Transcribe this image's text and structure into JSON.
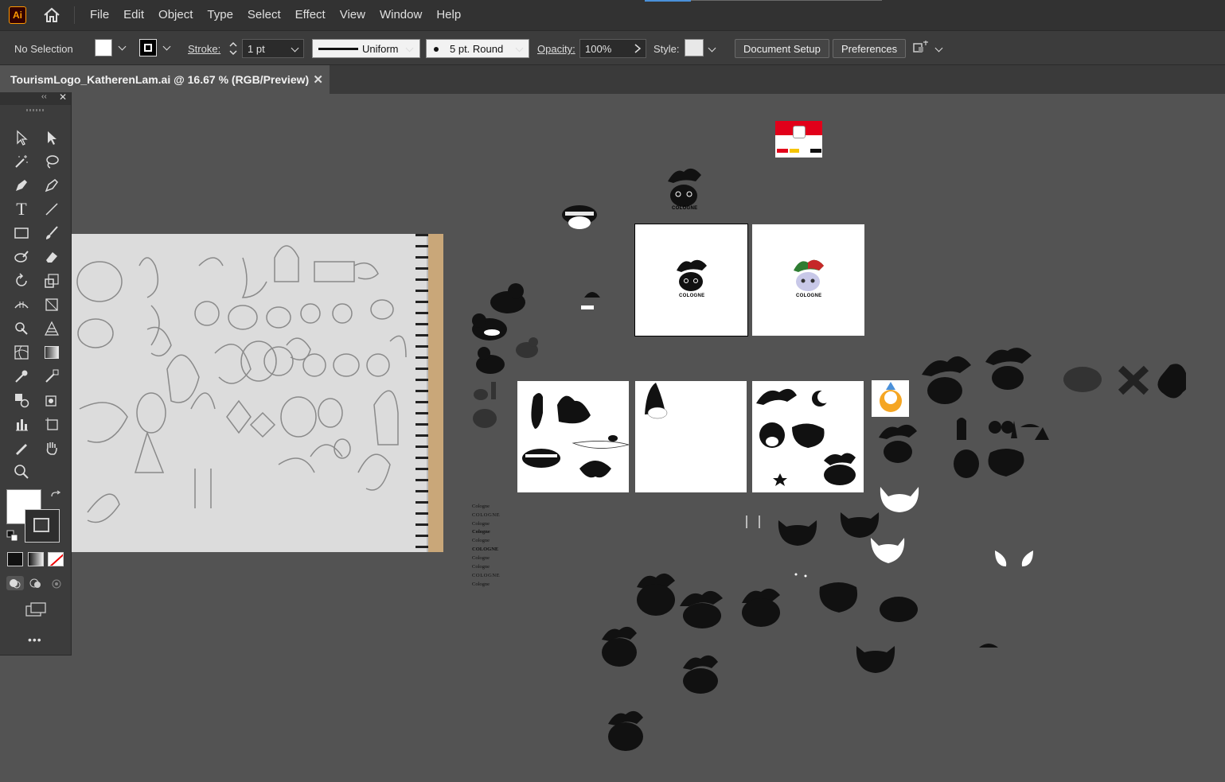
{
  "app": {
    "logo_text": "Ai"
  },
  "menu": [
    "File",
    "Edit",
    "Object",
    "Type",
    "Select",
    "Effect",
    "View",
    "Window",
    "Help"
  ],
  "control_bar": {
    "selection": "No Selection",
    "stroke_label": "Stroke:",
    "stroke_value": "1 pt",
    "profile": "Uniform",
    "brush": "5 pt. Round",
    "opacity_label": "Opacity:",
    "opacity_value": "100%",
    "style_label": "Style:",
    "document_setup": "Document Setup",
    "preferences": "Preferences"
  },
  "document_tab": {
    "title": "TourismLogo_KatherenLam.ai @ 16.67 % (RGB/Preview)",
    "close": "✕"
  },
  "artwork": {
    "cologne_label": "COLOGNE",
    "font_samples": [
      "Cologne",
      "COLOGNE",
      "Cologne",
      "Cologne",
      "Cologne",
      "COLOGNE",
      "Cologne",
      "Cologne",
      "COLOGNE",
      "Cologne"
    ]
  },
  "more_tools": "•••"
}
